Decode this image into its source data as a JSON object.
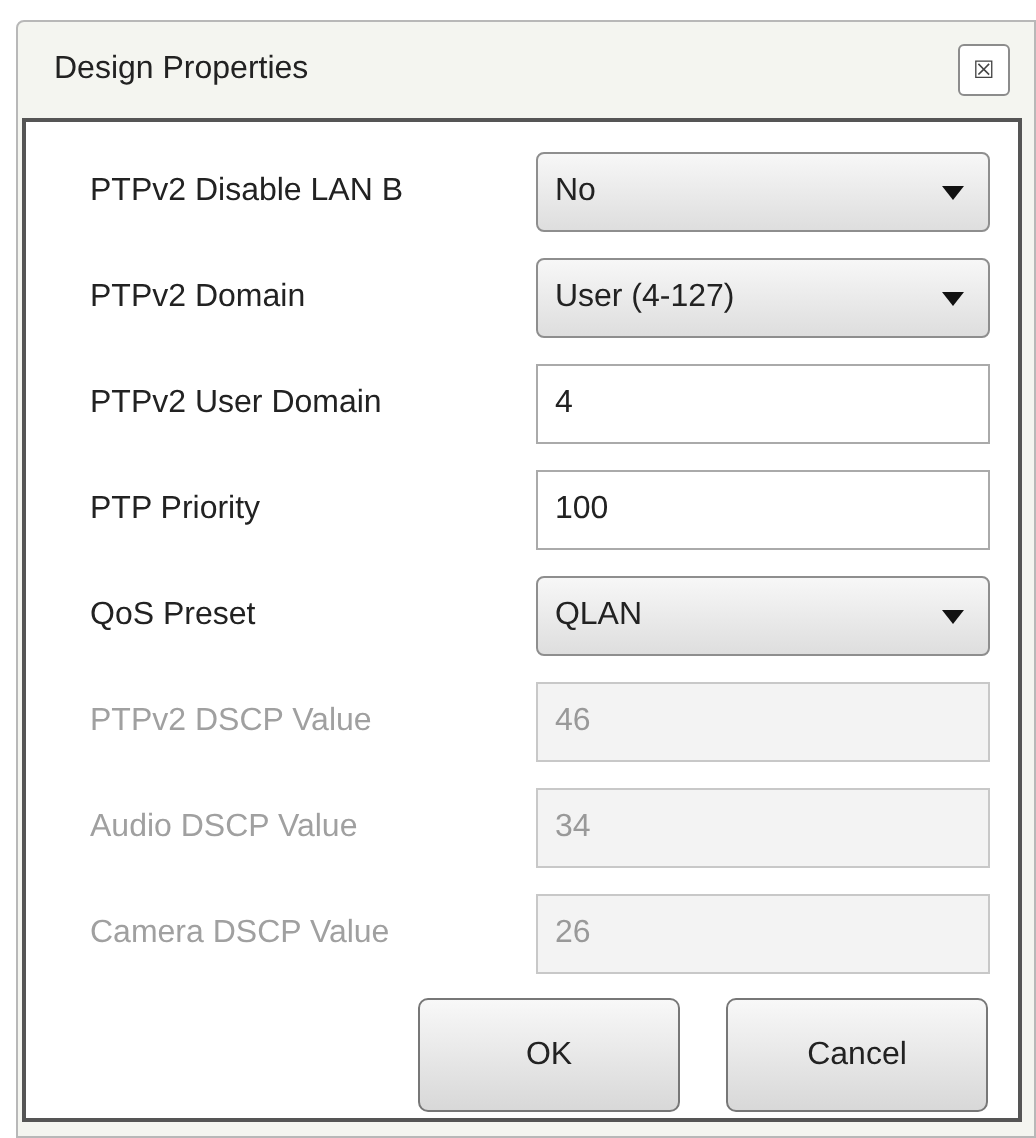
{
  "window": {
    "title": "Design Properties",
    "close": "☒"
  },
  "fields": [
    {
      "label": "PTPv2 Disable LAN B",
      "kind": "dropdown",
      "value": "No",
      "disabled": false
    },
    {
      "label": "PTPv2 Domain",
      "kind": "dropdown",
      "value": "User (4-127)",
      "disabled": false
    },
    {
      "label": "PTPv2 User Domain",
      "kind": "text",
      "value": "4",
      "disabled": false
    },
    {
      "label": "PTP Priority",
      "kind": "text",
      "value": "100",
      "disabled": false
    },
    {
      "label": "QoS Preset",
      "kind": "dropdown",
      "value": "QLAN",
      "disabled": false
    },
    {
      "label": "PTPv2 DSCP Value",
      "kind": "text",
      "value": "46",
      "disabled": true
    },
    {
      "label": "Audio DSCP Value",
      "kind": "text",
      "value": "34",
      "disabled": true
    },
    {
      "label": "Camera DSCP Value",
      "kind": "text",
      "value": "26",
      "disabled": true
    }
  ],
  "buttons": [
    "OK",
    "Cancel"
  ]
}
